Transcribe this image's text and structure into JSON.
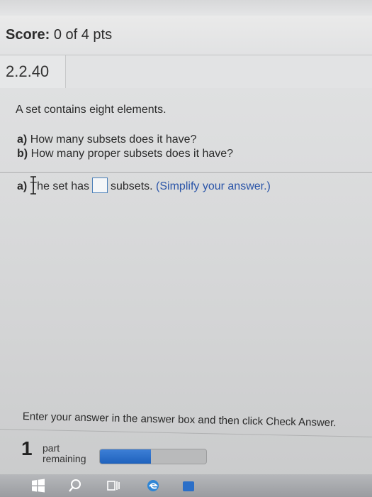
{
  "header": {
    "score_label": "Score:",
    "score_value": "0 of 4 pts"
  },
  "question": {
    "number": "2.2.40",
    "prompt": "A set contains eight elements.",
    "parts": [
      {
        "marker": "a)",
        "text": "How many subsets does it have?"
      },
      {
        "marker": "b)",
        "text": "How many proper subsets does it have?"
      }
    ]
  },
  "answer": {
    "marker": "a)",
    "prefix": "The set has",
    "input_value": "",
    "suffix": "subsets.",
    "hint": "(Simplify your answer.)"
  },
  "footer": {
    "instruction": "Enter your answer in the answer box and then click Check Answer.",
    "parts_remaining_count": "1",
    "parts_remaining_line1": "part",
    "parts_remaining_line2": "remaining",
    "progress_fraction": 0.48,
    "progress_color": "#2a6fcb"
  },
  "taskbar": {
    "icons": [
      "windows-start-icon",
      "search-icon",
      "task-view-icon",
      "edge-browser-icon",
      "app-icon"
    ]
  }
}
